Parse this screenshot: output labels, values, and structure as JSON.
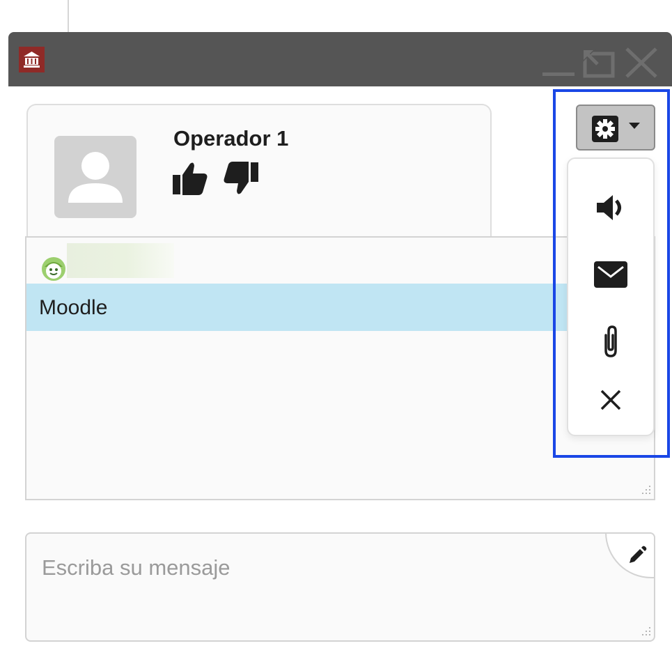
{
  "window": {
    "logo_icon": "university-building-icon",
    "controls": [
      "minimize-icon",
      "restore-icon",
      "close-icon"
    ]
  },
  "operator": {
    "name": "Operador 1",
    "avatar_icon": "user-silhouette-icon",
    "rating_icons": [
      "thumbs-up-icon",
      "thumbs-down-icon"
    ]
  },
  "chat": {
    "user_icon": "smiley-icon",
    "messages": [
      {
        "text": "Moodle"
      }
    ]
  },
  "input": {
    "placeholder": "Escriba su mensaje",
    "value": "",
    "edit_icon": "pencil-icon"
  },
  "menu": {
    "button_icons": [
      "gear-icon",
      "caret-down-icon"
    ],
    "items": [
      {
        "icon": "speaker-icon"
      },
      {
        "icon": "envelope-icon"
      },
      {
        "icon": "paperclip-icon"
      },
      {
        "icon": "close-icon"
      }
    ]
  },
  "colors": {
    "titlebar": "#555555",
    "logo": "#8f2a27",
    "selected_message": "#c0e5f3",
    "highlight_border": "#1a47e6"
  }
}
